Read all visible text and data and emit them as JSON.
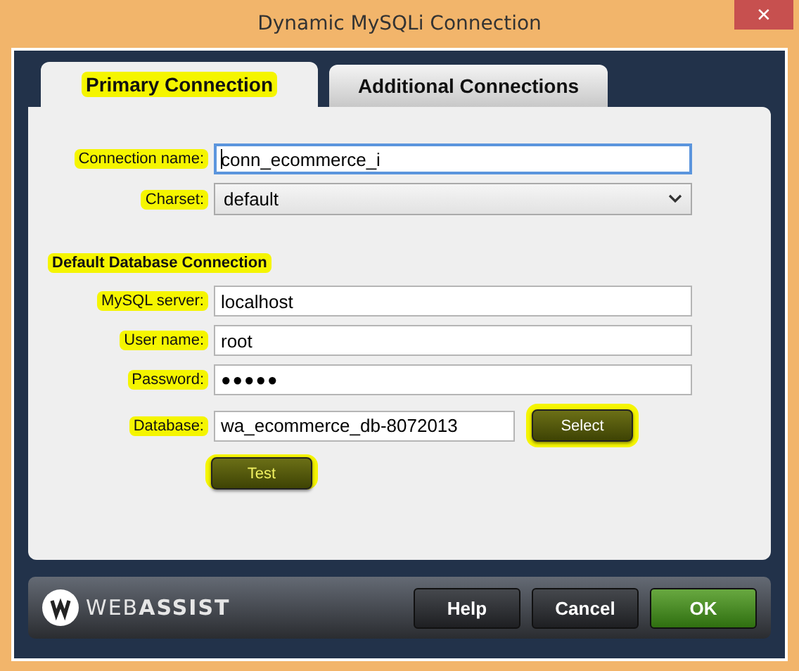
{
  "window": {
    "title": "Dynamic MySQLi Connection",
    "close": "✕"
  },
  "tabs": [
    {
      "label": "Primary Connection",
      "selected": true,
      "highlighted": true
    },
    {
      "label": "Additional Connections",
      "selected": false,
      "highlighted": false
    }
  ],
  "fields": [
    {
      "label": "Connection name:",
      "kind": "text",
      "value": "conn_ecommerce_i",
      "focused": true,
      "highlighted": true
    },
    {
      "label": "Charset:",
      "kind": "select",
      "value": "default",
      "highlighted": true
    }
  ],
  "section": {
    "title": "Default Database Connection",
    "highlighted": true
  },
  "db_fields": [
    {
      "label": "MySQL server:",
      "kind": "text",
      "value": "localhost",
      "highlighted": true
    },
    {
      "label": "User name:",
      "kind": "text",
      "value": "root",
      "highlighted": true
    },
    {
      "label": "Password:",
      "kind": "password",
      "value": "●●●●●",
      "highlighted": true
    },
    {
      "label": "Database:",
      "kind": "database",
      "value": "wa_ecommerce_db-8072013",
      "highlighted": true,
      "button": "Select"
    }
  ],
  "test_button": "Test",
  "footer": {
    "brand": "WEB**ASSIST**",
    "buttons": [
      {
        "label": "Help",
        "kind": "normal"
      },
      {
        "label": "Cancel",
        "kind": "normal"
      },
      {
        "label": "OK",
        "kind": "primary"
      }
    ]
  }
}
